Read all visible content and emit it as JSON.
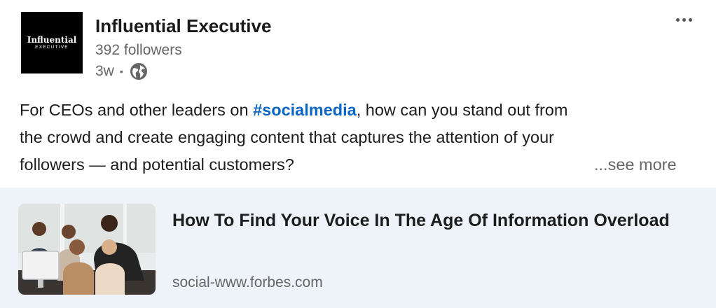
{
  "author": {
    "name": "Influential Executive",
    "logo_text": "Influential",
    "logo_subtext": "EXECUTIVE",
    "followers": "392 followers",
    "time": "3w",
    "separator": "•",
    "visibility_icon": "globe-icon"
  },
  "menu": {
    "icon": "more-options-icon"
  },
  "post": {
    "line1_before": "For CEOs and other leaders on ",
    "hashtag": "#socialmedia",
    "line1_after": ", how can you stand out from",
    "line2": "the crowd and create engaging content that captures the attention of your",
    "line3": "followers — and potential customers?",
    "see_more": "...see more"
  },
  "link_card": {
    "title": "How To Find Your Voice In The Age Of Information Overload",
    "source": "social-www.forbes.com",
    "image": "photo of colleagues gathered around a computer"
  },
  "colors": {
    "hashtag": "#0a66c2",
    "card_bg": "#edf3f8",
    "muted": "#666666"
  }
}
